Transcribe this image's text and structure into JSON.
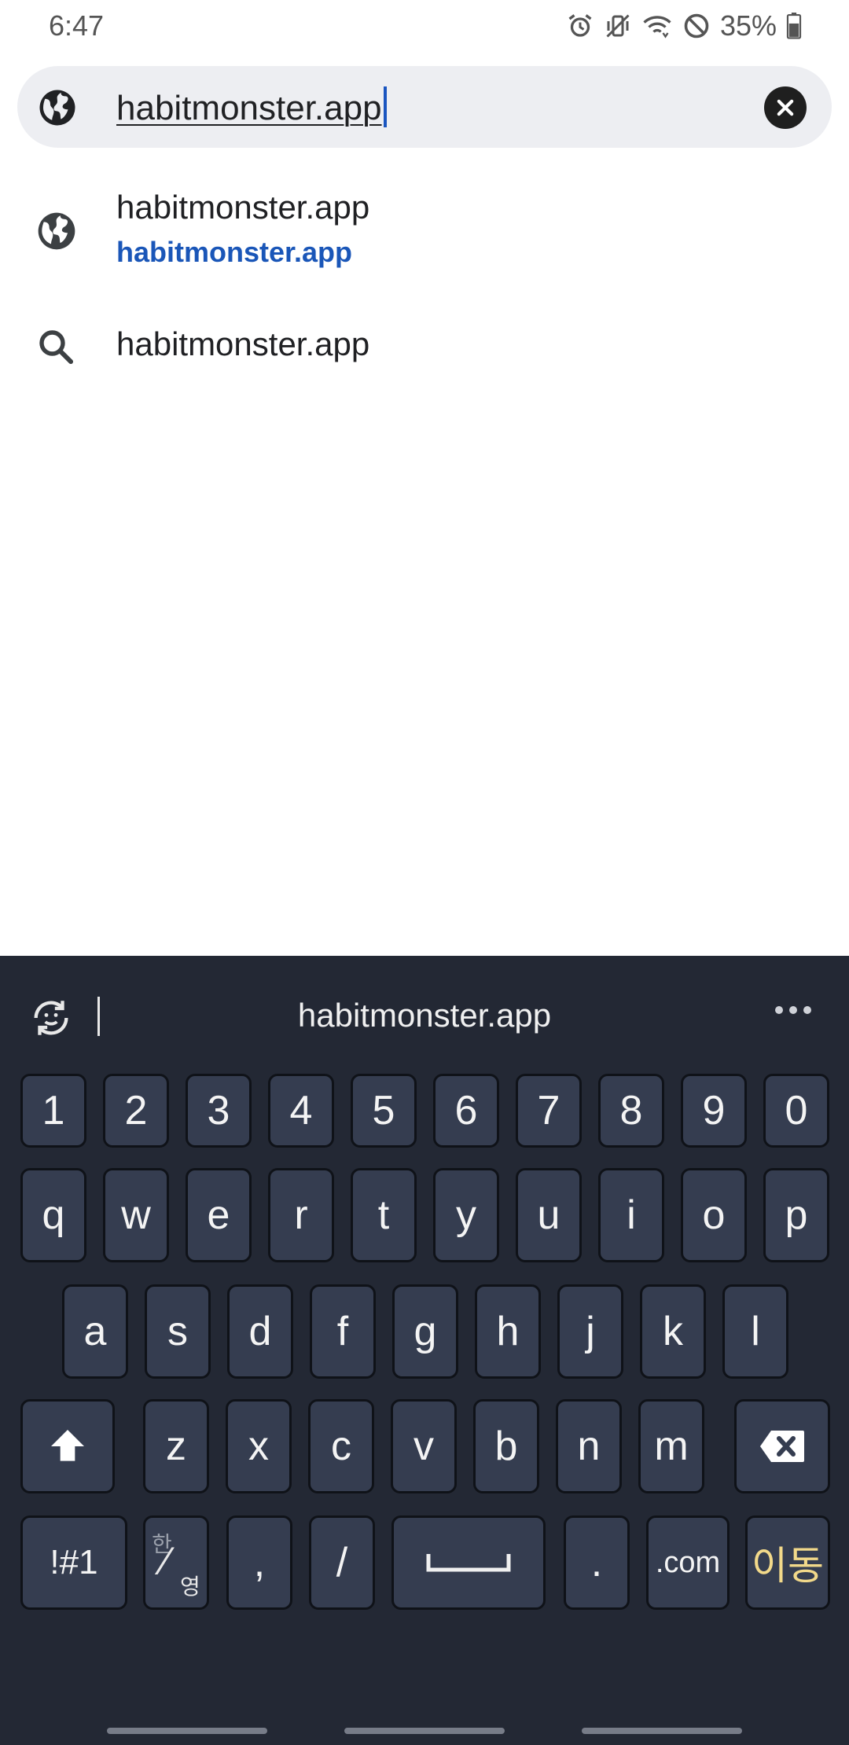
{
  "status_bar": {
    "time": "6:47",
    "battery": "35%",
    "icons": [
      "alarm-icon",
      "vibrate-icon",
      "wifi-icon",
      "do-not-disturb-icon",
      "battery-icon"
    ]
  },
  "omnibox": {
    "text": "habitmonster.app",
    "icon": "globe-icon",
    "clear_icon": "close-icon"
  },
  "suggestions": [
    {
      "icon": "globe-icon",
      "title": "habitmonster.app",
      "url": "habitmonster.app"
    },
    {
      "icon": "search-icon",
      "title": "habitmonster.app"
    }
  ],
  "keyboard": {
    "suggestion_text": "habitmonster.app",
    "number_row": [
      "1",
      "2",
      "3",
      "4",
      "5",
      "6",
      "7",
      "8",
      "9",
      "0"
    ],
    "row1": [
      "q",
      "w",
      "e",
      "r",
      "t",
      "y",
      "u",
      "i",
      "o",
      "p"
    ],
    "row2": [
      "a",
      "s",
      "d",
      "f",
      "g",
      "h",
      "j",
      "k",
      "l"
    ],
    "row3": [
      "z",
      "x",
      "c",
      "v",
      "b",
      "n",
      "m"
    ],
    "bottom": {
      "symbols": "!#1",
      "lang_top": "한",
      "lang_bottom": "영",
      "comma": ",",
      "slash": "/",
      "period": ".",
      "dotcom": ".com",
      "go": "이동"
    }
  },
  "colors": {
    "link": "#1a56b8",
    "keyboard_bg": "#232834",
    "key_bg": "#353d50",
    "go_key_text": "#f2d98a"
  }
}
